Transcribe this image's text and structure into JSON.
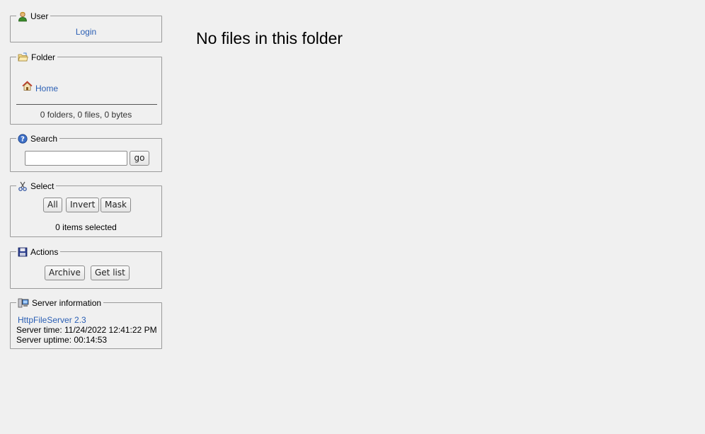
{
  "user": {
    "title": "User",
    "login_label": "Login"
  },
  "folder": {
    "title": "Folder",
    "home_label": "Home",
    "stats": "0 folders, 0 files, 0 bytes"
  },
  "search": {
    "title": "Search",
    "query": "",
    "go_label": "go"
  },
  "select": {
    "title": "Select",
    "all_label": "All",
    "invert_label": "Invert",
    "mask_label": "Mask",
    "status": "0 items selected"
  },
  "actions": {
    "title": "Actions",
    "archive_label": "Archive",
    "getlist_label": "Get list"
  },
  "server": {
    "title": "Server information",
    "software_link": "HttpFileServer 2.3",
    "time_line": "Server time: 11/24/2022 12:41:22 PM",
    "uptime_line": "Server uptime: 00:14:53"
  },
  "main": {
    "message": "No files in this folder"
  },
  "icons": [
    "user-icon",
    "folder-icon",
    "home-icon",
    "help-icon",
    "scissors-icon",
    "save-icon",
    "server-icon"
  ]
}
